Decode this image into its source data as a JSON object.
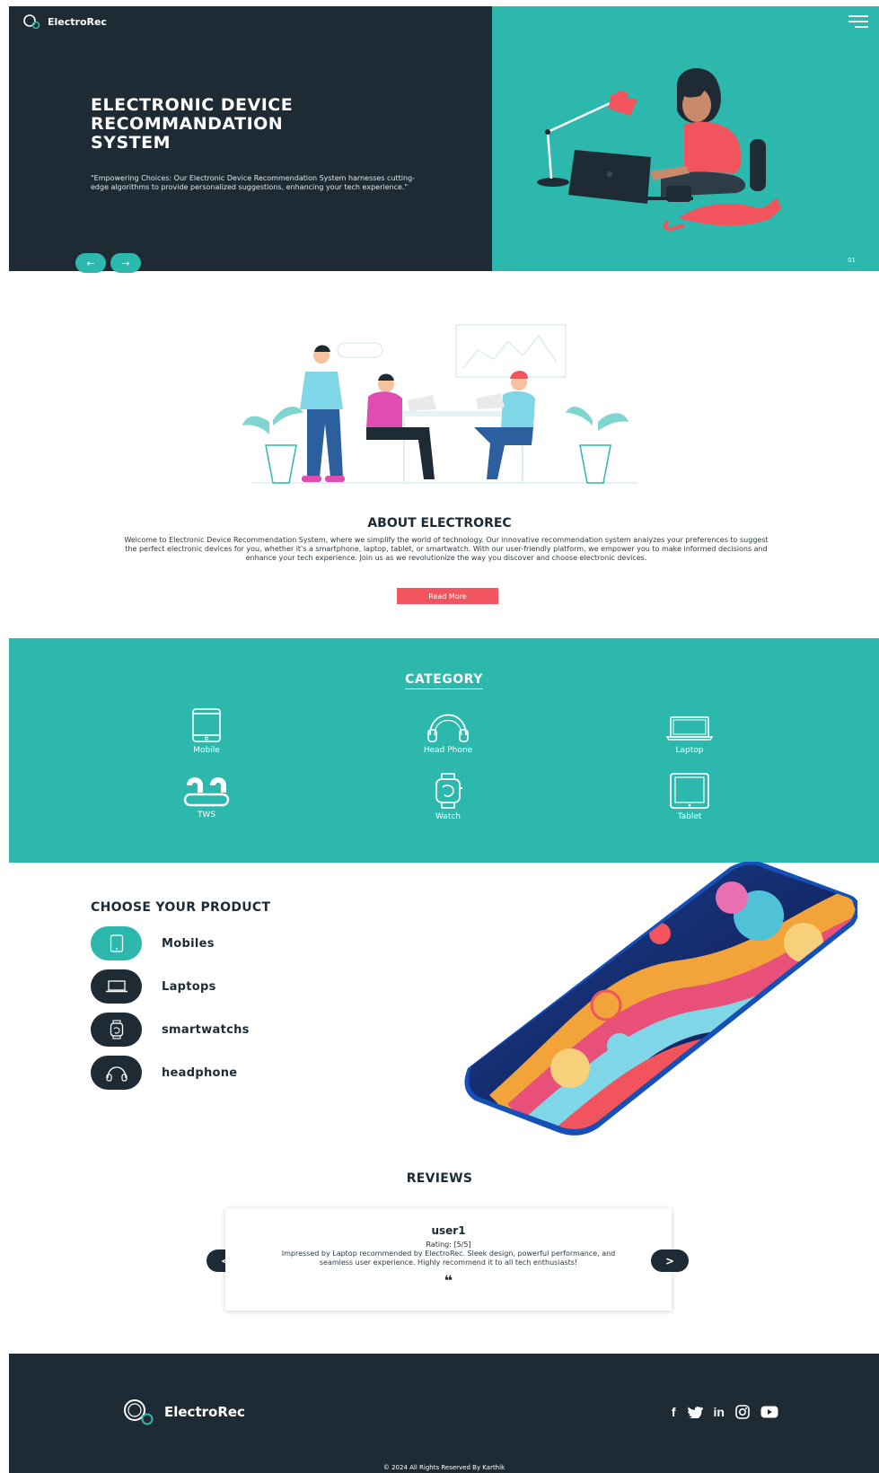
{
  "brand": {
    "name": "ElectroRec"
  },
  "colors": {
    "dark": "#1e2b35",
    "teal": "#2db8ad",
    "accent": "#f1545c"
  },
  "hero": {
    "title": "ELECTRONIC DEVICE RECOMMANDATION SYSTEM",
    "tagline": "\"Empowering Choices: Our Electronic Device Recommendation System harnesses cutting-edge algorithms to provide personalized suggestions, enhancing your tech experience.\"",
    "prev_icon": "←",
    "next_icon": "→",
    "slide_number": "01"
  },
  "about": {
    "title": "ABOUT ELECTROREC",
    "text": "Welcome to Electronic Device Recommendation System, where we simplify the world of technology. Our innovative recommendation system analyzes your preferences to suggest the perfect electronic devices for you, whether it's a smartphone, laptop, tablet, or smartwatch. With our user-friendly platform, we empower you to make informed decisions and enhance your tech experience. Join us as we revolutionize the way you discover and choose electronic devices.",
    "button": "Read More"
  },
  "category": {
    "title": "CATEGORY",
    "items": [
      {
        "label": "Mobile",
        "icon": "mobile-icon"
      },
      {
        "label": "Head Phone",
        "icon": "headphone-icon"
      },
      {
        "label": "Laptop",
        "icon": "laptop-icon"
      },
      {
        "label": "TWS",
        "icon": "earbuds-icon"
      },
      {
        "label": "Watch",
        "icon": "watch-icon"
      },
      {
        "label": "Tablet",
        "icon": "tablet-icon"
      }
    ]
  },
  "products": {
    "title": "CHOOSE YOUR PRODUCT",
    "items": [
      {
        "label": "Mobiles",
        "icon": "mobile-icon",
        "active": true
      },
      {
        "label": "Laptops",
        "icon": "laptop-icon"
      },
      {
        "label": "smartwatchs",
        "icon": "watch-icon"
      },
      {
        "label": "headphone",
        "icon": "headphone-icon"
      }
    ]
  },
  "reviews": {
    "title": "REVIEWS",
    "user": "user1",
    "rating": "Rating: [5/5]",
    "text": "Impressed by Laptop recommended by ElectroRec. Sleek design, powerful performance, and seamless user experience. Highly recommend it to all tech enthusiasts!",
    "quote": "❝",
    "prev": "<",
    "next": ">"
  },
  "footer": {
    "brand": "ElectroRec",
    "social": [
      "f",
      "twitter",
      "in",
      "instagram",
      "youtube"
    ],
    "copyright": "© 2024 All Rights Reserved By Karthik"
  }
}
